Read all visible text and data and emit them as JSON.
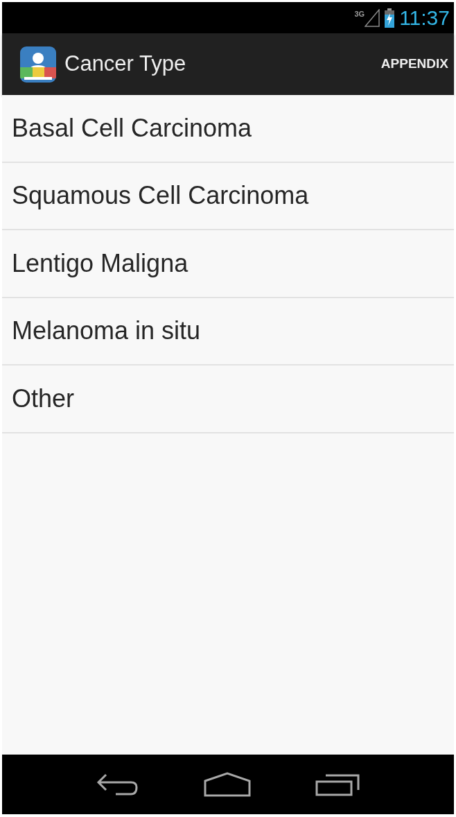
{
  "status_bar": {
    "network": "3G",
    "time": "11:37"
  },
  "action_bar": {
    "title": "Cancer Type",
    "action": "APPENDIX"
  },
  "list": [
    {
      "label": "Basal Cell Carcinoma"
    },
    {
      "label": "Squamous Cell Carcinoma"
    },
    {
      "label": "Lentigo Maligna"
    },
    {
      "label": "Melanoma in situ"
    },
    {
      "label": "Other"
    }
  ]
}
